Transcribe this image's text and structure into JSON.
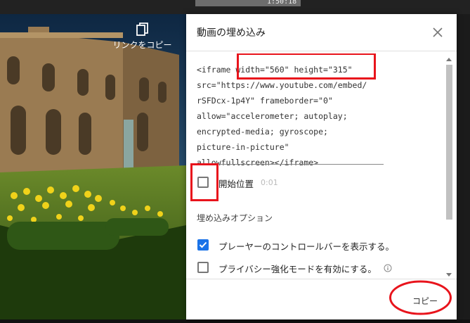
{
  "background": {
    "thumb_time": "1:50:18",
    "copy_link_label": "リンクをコピー"
  },
  "dialog": {
    "title": "動画の埋め込み",
    "embed_code": "<iframe width=\"560\" height=\"315\"\nsrc=\"https://www.youtube.com/embed/\nrSFDcx-1p4Y\" frameborder=\"0\"\nallow=\"accelerometer; autoplay;\nencrypted-media; gyroscope;\npicture-in-picture\"\nallowfullscreen></iframe>",
    "start_at_label": "開始位置",
    "start_at_time": "0:01",
    "options_title": "埋め込みオプション",
    "options": [
      {
        "label": "プレーヤーのコントロールバーを表示する。",
        "checked": true
      },
      {
        "label": "プライバシー強化モードを有効にする。",
        "checked": false
      }
    ],
    "copy_button": "コピー"
  },
  "colors": {
    "accent": "#1a73e8",
    "highlight_red": "#e8141c"
  }
}
